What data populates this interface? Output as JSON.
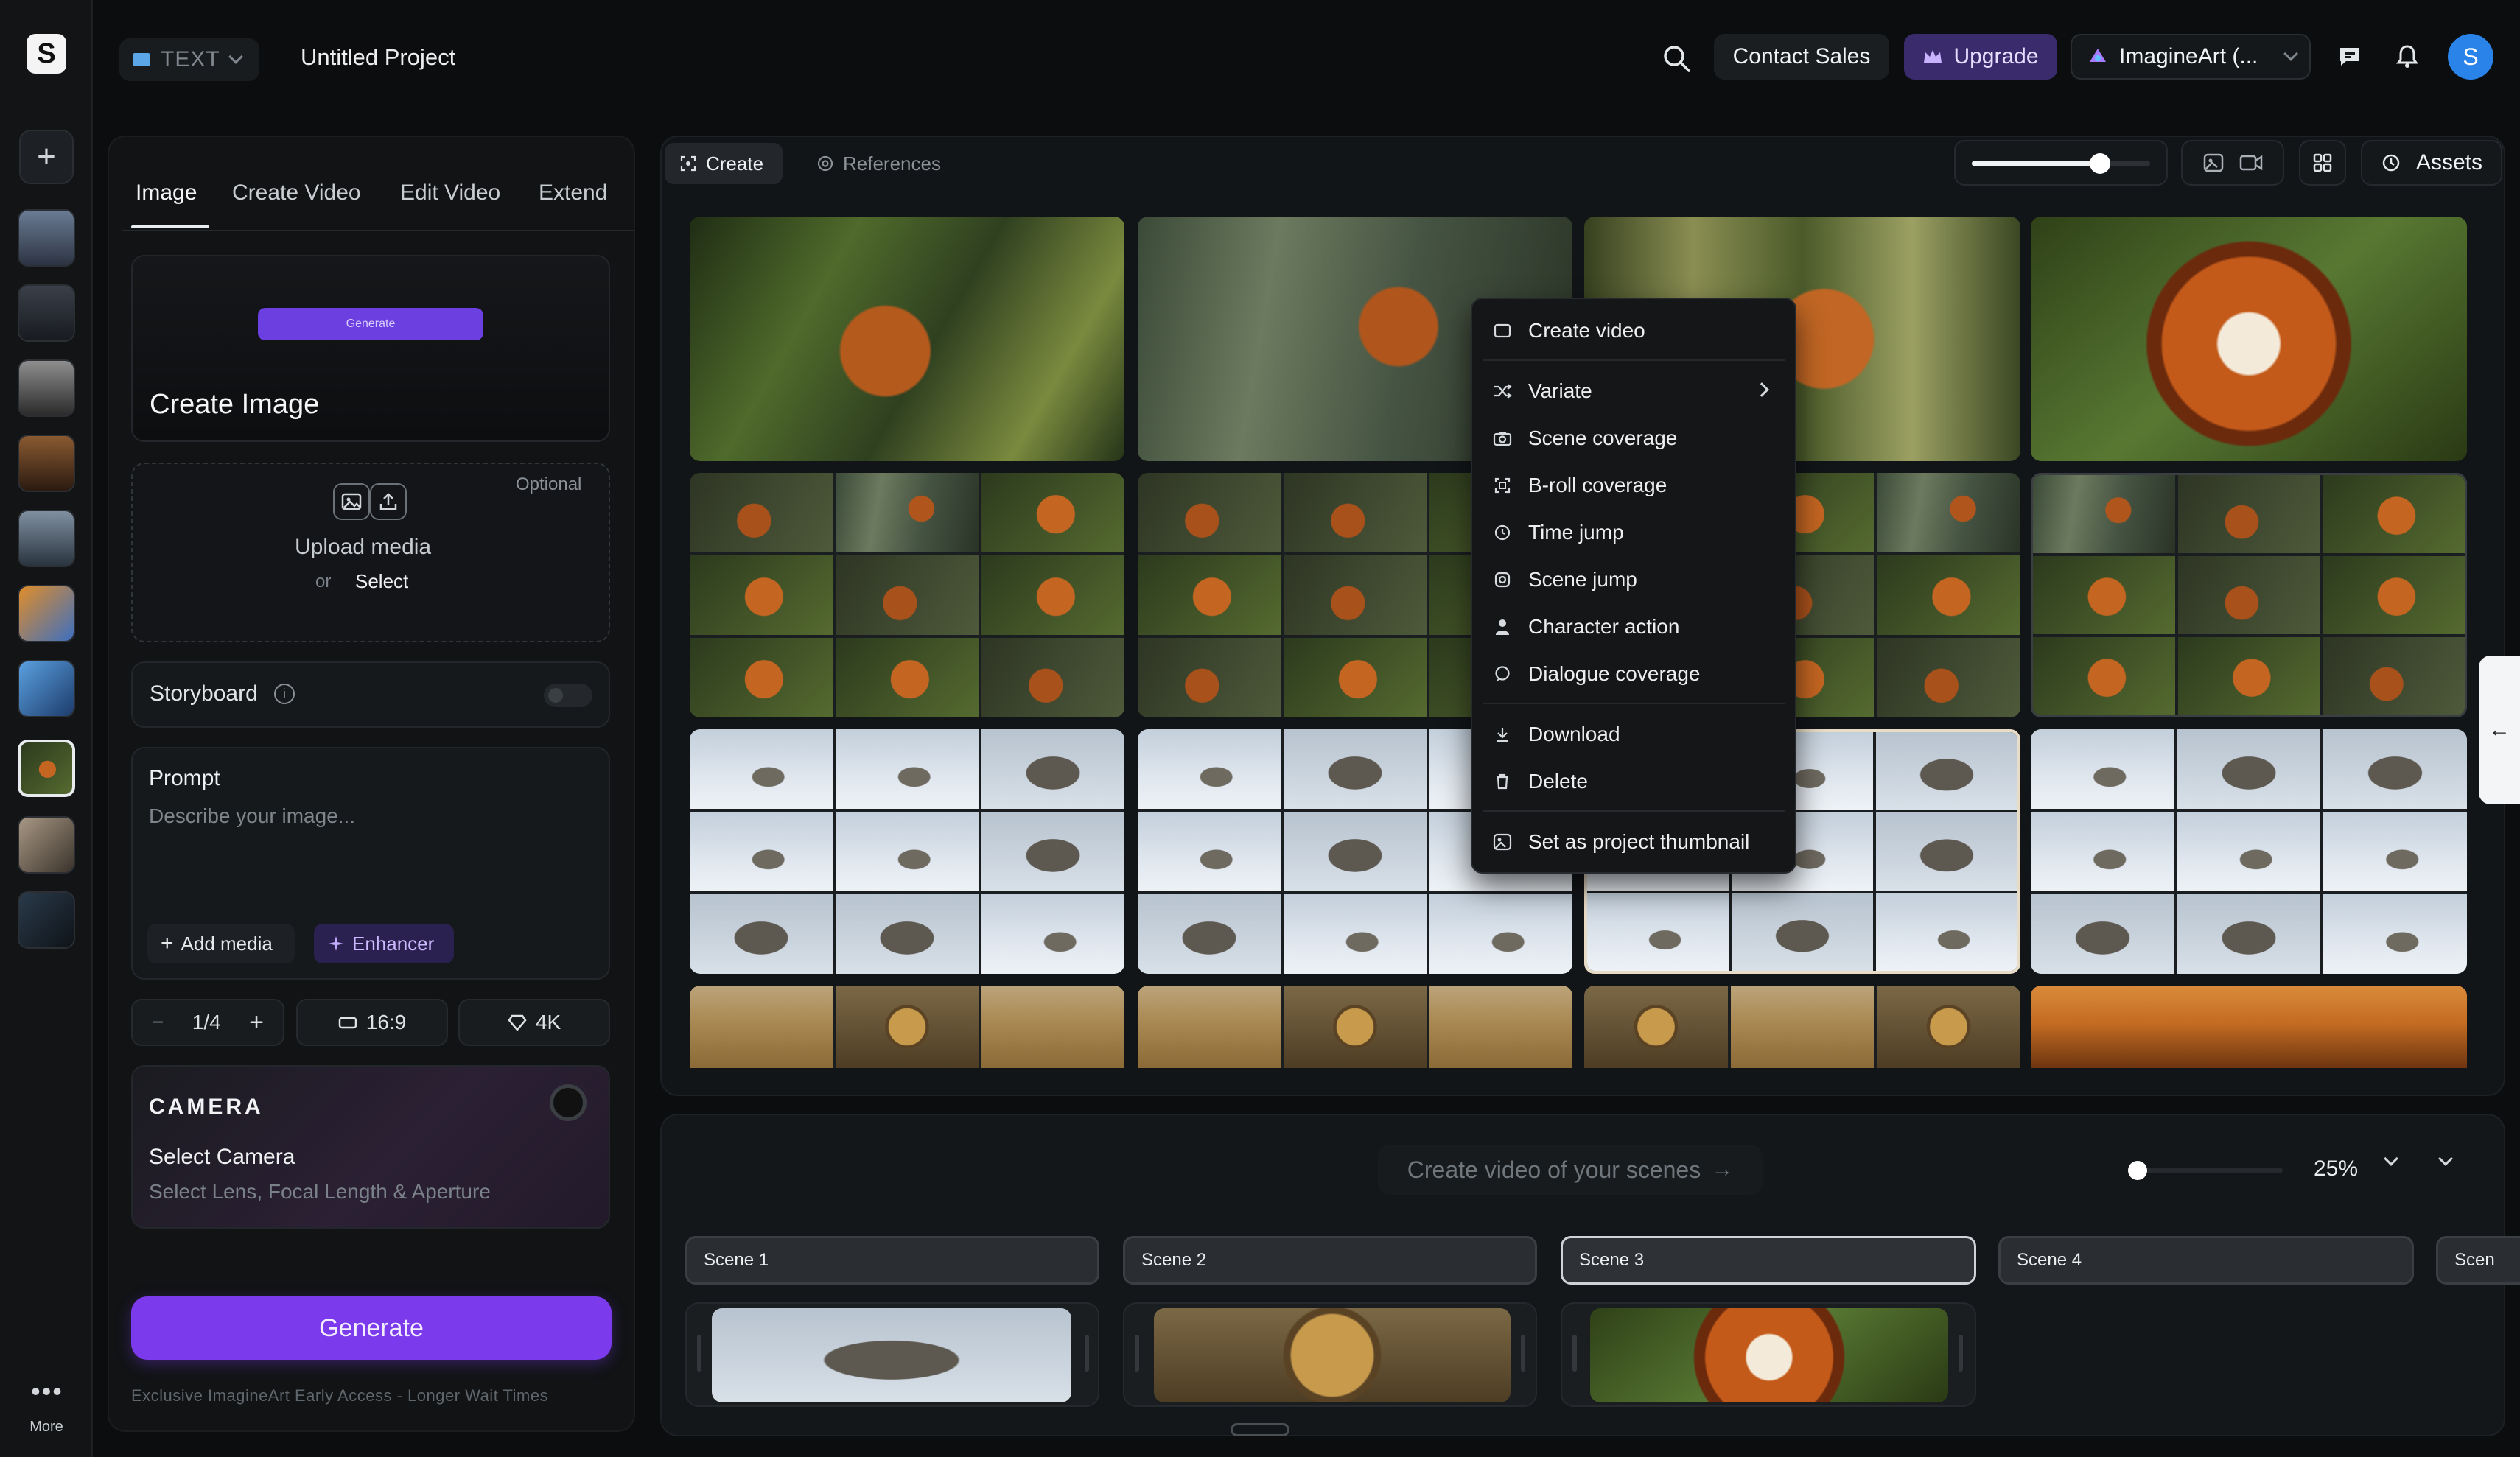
{
  "app": {
    "project_type": "TEXT",
    "project_title": "Untitled Project",
    "brand_colors": {
      "accent": "#7c3aed",
      "upgrade_bg": "#3a2b6d",
      "avatar": "#2a83e8"
    }
  },
  "rail": {
    "add_icon": "plus-icon",
    "more_dots": "•••",
    "more_label": "More"
  },
  "topbar": {
    "contact_sales": "Contact Sales",
    "upgrade": "Upgrade",
    "workspace": "ImagineArt (...",
    "avatar_initial": "S"
  },
  "panel": {
    "tabs": [
      "Image",
      "Create Video",
      "Edit Video",
      "Extend"
    ],
    "active_tab": "Image",
    "create_card": {
      "pill": "Generate",
      "title": "Create Image"
    },
    "upload": {
      "optional": "Optional",
      "label": "Upload media",
      "or": "or",
      "select": "Select"
    },
    "storyboard": {
      "label": "Storyboard",
      "enabled": false
    },
    "prompt": {
      "label": "Prompt",
      "placeholder": "Describe your image...",
      "value": ""
    },
    "chips": {
      "add_media": "Add media",
      "enhancer": "Enhancer"
    },
    "options": {
      "count": "1/4",
      "minus": "−",
      "plus": "+",
      "aspect": "16:9",
      "quality": "4K"
    },
    "camera": {
      "title": "CAMERA",
      "select": "Select Camera",
      "sub": "Select Lens, Focal Length & Aperture"
    },
    "generate": "Generate",
    "footer_note": "Exclusive ImagineArt Early Access - Longer Wait Times"
  },
  "main": {
    "tabs": {
      "create": "Create",
      "references": "References"
    },
    "zoom_level": 0.72,
    "assets": "Assets"
  },
  "context_menu": {
    "items": [
      {
        "label": "Create video",
        "icon": "video-frame-icon"
      },
      {
        "label": "Variate",
        "icon": "shuffle-icon",
        "has_submenu": true
      },
      {
        "label": "Scene coverage",
        "icon": "camera-icon"
      },
      {
        "label": "B-roll coverage",
        "icon": "frame-icon"
      },
      {
        "label": "Time jump",
        "icon": "clock-icon"
      },
      {
        "label": "Scene jump",
        "icon": "jump-icon"
      },
      {
        "label": "Character action",
        "icon": "person-icon"
      },
      {
        "label": "Dialogue coverage",
        "icon": "chat-icon"
      },
      {
        "label": "Download",
        "icon": "download-icon"
      },
      {
        "label": "Delete",
        "icon": "trash-icon"
      },
      {
        "label": "Set as project thumbnail",
        "icon": "image-icon"
      }
    ]
  },
  "timeline": {
    "create_video_cta": "Create video of your scenes",
    "zoom_percent": "25%",
    "scenes": [
      "Scene 1",
      "Scene 2",
      "Scene 3",
      "Scene 4",
      "Scen"
    ],
    "active_scene": "Scene 3"
  }
}
